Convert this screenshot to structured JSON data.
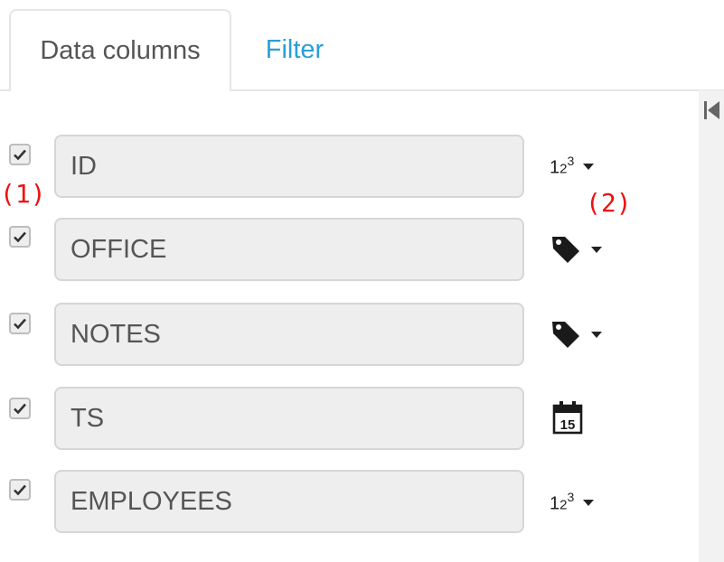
{
  "tabs": {
    "data_columns_label": "Data columns",
    "filter_label": "Filter"
  },
  "colors": {
    "tab_link": "#2a9fd6",
    "annotation": "#ee1111",
    "field_bg": "#eeeeee"
  },
  "columns": [
    {
      "name": "ID",
      "checked": true,
      "type_icon": "numeric-123-icon",
      "type_label": "123",
      "has_dropdown": true
    },
    {
      "name": "OFFICE",
      "checked": true,
      "type_icon": "tag-icon",
      "has_dropdown": true
    },
    {
      "name": "NOTES",
      "checked": true,
      "type_icon": "tag-icon",
      "has_dropdown": true
    },
    {
      "name": "TS",
      "checked": true,
      "type_icon": "calendar-icon",
      "calendar_day": "15",
      "has_dropdown": false
    },
    {
      "name": "EMPLOYEES",
      "checked": true,
      "type_icon": "numeric-123-icon",
      "type_label": "123",
      "has_dropdown": true
    }
  ],
  "annotations": {
    "label_1": "(1)",
    "label_2": "(2)"
  }
}
